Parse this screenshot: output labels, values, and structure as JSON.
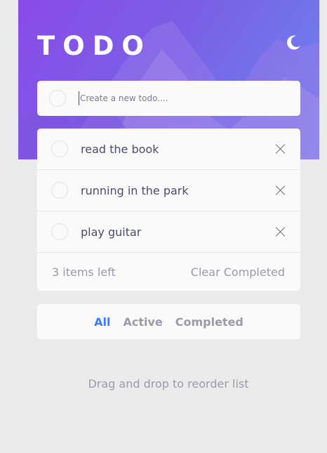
{
  "app": {
    "title": "TODO"
  },
  "icons": {
    "theme": "moon-icon",
    "delete": "cross-icon"
  },
  "colors": {
    "accent": "#3a7bfd",
    "text": "#494c6b",
    "muted": "#9a9baa"
  },
  "new_todo": {
    "placeholder": "Create a new todo....",
    "value": ""
  },
  "todos": [
    {
      "text": "read the book"
    },
    {
      "text": "running in the park"
    },
    {
      "text": "play guitar"
    }
  ],
  "footer": {
    "items_left": "3 items left",
    "clear_label": "Clear Completed"
  },
  "filters": {
    "all": "All",
    "active": "Active",
    "completed": "Completed",
    "selected": "All"
  },
  "hint": "Drag and drop to reorder list"
}
